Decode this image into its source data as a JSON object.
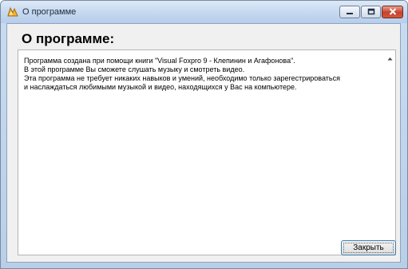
{
  "window": {
    "title": "О программе",
    "app_icon": "app-logo-icon"
  },
  "caption_buttons": {
    "minimize_icon": "minimize-icon",
    "maximize_icon": "maximize-icon",
    "close_icon": "close-icon"
  },
  "content": {
    "heading": "О программе:",
    "text": "Программа создана при помощи книги \"Visual Foxpro 9 - Клепинин и Агафонова\".\nВ этой программе Вы сможете слушать музыку и смотреть видео.\nЭта программа не требует никаких навыков и умений, необходимо только зарегестрироваться\nи наслаждаться любимыми музыкой и видео, находящихся у Вас на компьютере."
  },
  "buttons": {
    "close_label": "Закрыть"
  },
  "colors": {
    "titlebar": "#c6d9f0",
    "close_caption": "#c8402b",
    "client_bg": "#f0f0f0",
    "focus_border": "#3c7fb1"
  }
}
